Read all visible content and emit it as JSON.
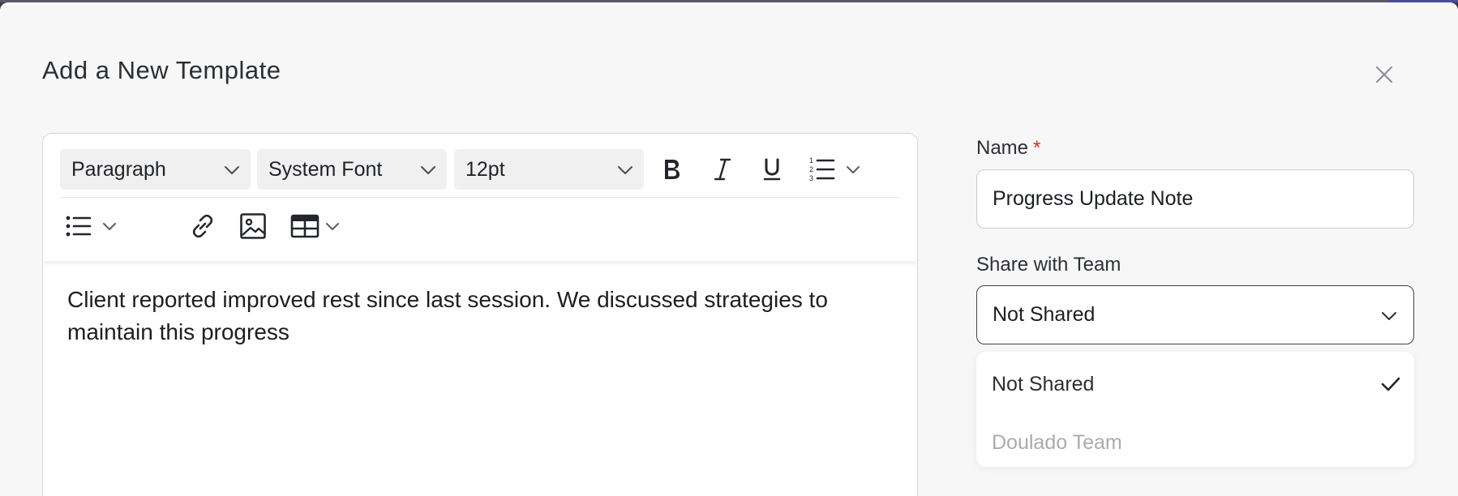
{
  "modal": {
    "title": "Add a New Template"
  },
  "toolbar": {
    "block_format": "Paragraph",
    "font_family": "System Font",
    "font_size": "12pt"
  },
  "editor": {
    "content": "Client reported improved rest since last session. We discussed strategies to maintain this progress"
  },
  "form": {
    "name_label": "Name",
    "name_required_mark": "*",
    "name_value": "Progress Update Note",
    "share_label": "Share with Team",
    "share_value": "Not Shared",
    "share_options": [
      {
        "label": "Not Shared",
        "selected": true,
        "disabled": false
      },
      {
        "label": "Doulado Team",
        "selected": false,
        "disabled": true
      }
    ]
  },
  "colors": {
    "required": "#d93025",
    "modal_bg": "#f7f7f7",
    "disabled_text": "#a8abb0"
  },
  "icons": [
    "close-icon",
    "bold-icon",
    "italic-icon",
    "underline-icon",
    "numbered-list-icon",
    "bullet-list-icon",
    "link-icon",
    "image-icon",
    "table-icon",
    "chevron-down-icon",
    "check-icon"
  ]
}
